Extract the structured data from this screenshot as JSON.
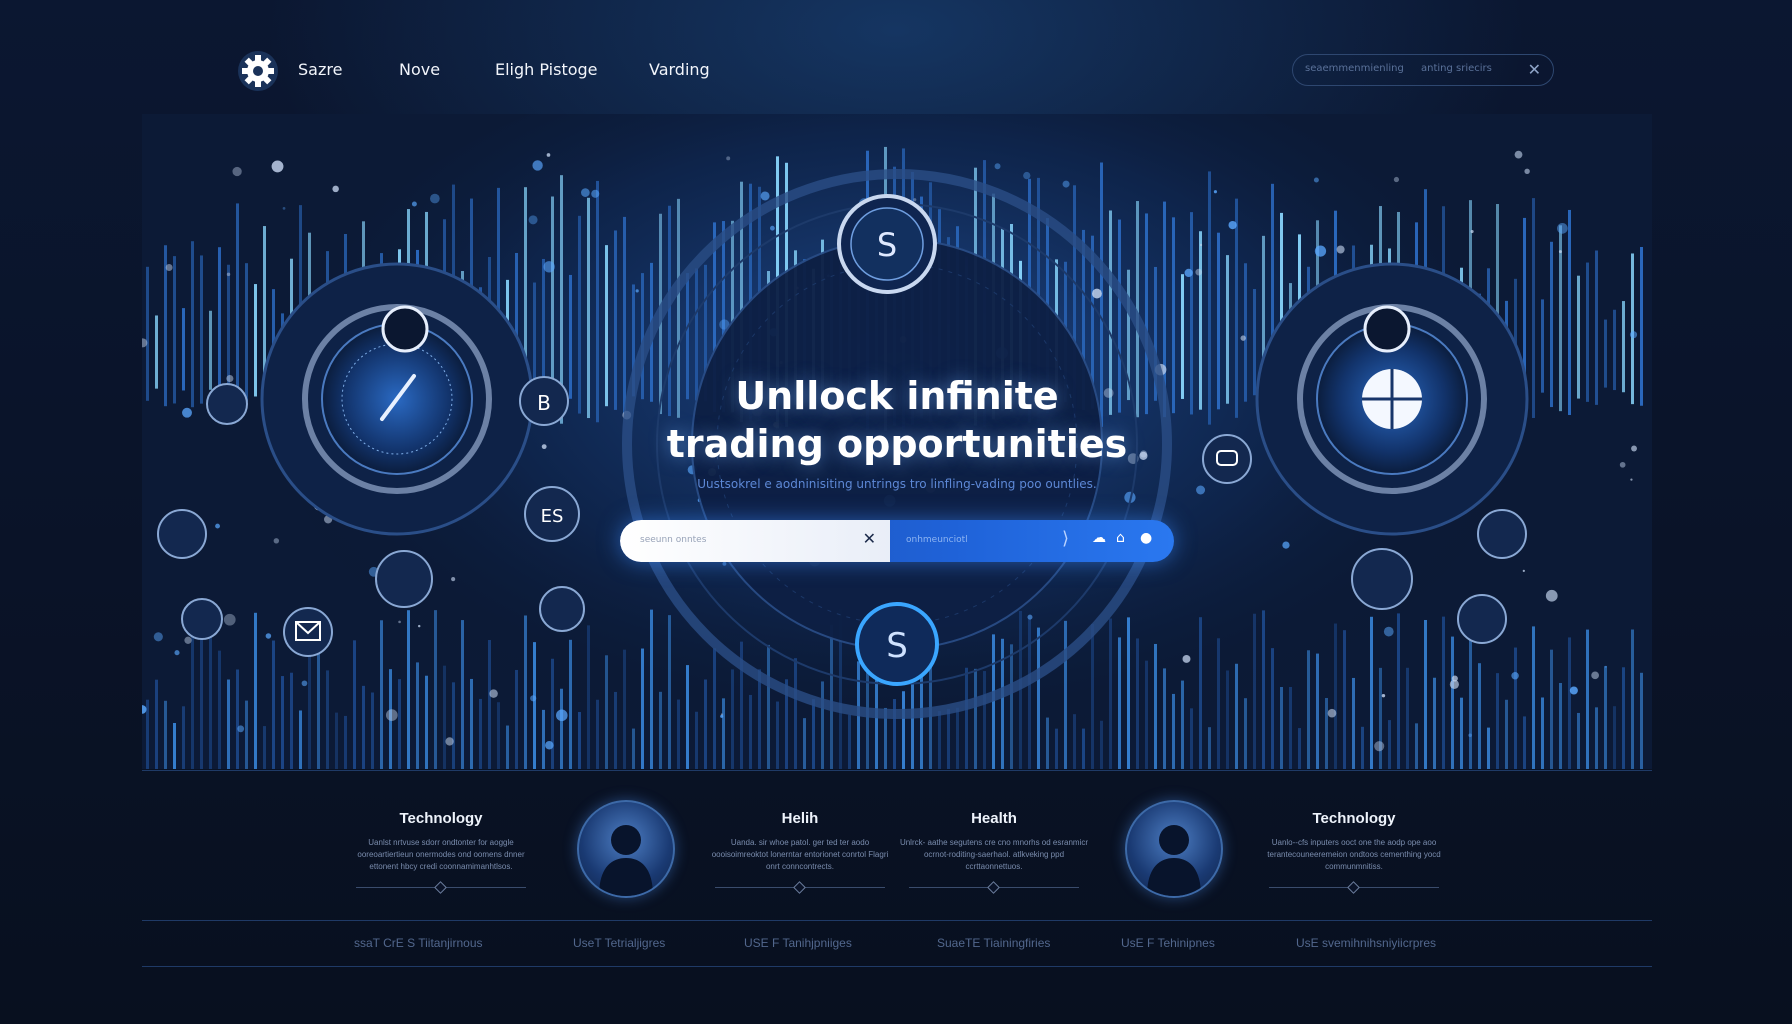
{
  "nav": {
    "links": [
      "Sazre",
      "Nove",
      "Eligh Pistoge",
      "Varding"
    ],
    "search_placeholder": "seaemmenmienling",
    "search_hint": "anting sriecirs",
    "close_icon": "close-icon"
  },
  "hero": {
    "headline_line1": "Unllock infinite",
    "headline_line2": "trading opportunities",
    "subheadline": "Uustsokrel e aodninisiting untrings tro linfling-vading poo ountlies.",
    "search": {
      "placeholder": "seeunn onntes",
      "secondary_placeholder": "onhmeunciotl",
      "icons": [
        "cloud-icon",
        "building-icon",
        "user-icon"
      ]
    }
  },
  "features": [
    {
      "title": "Technology",
      "desc": "Uanlst nrtvuse sdorr ondtonter for aoggle ooreoartiertieun onermodes ond oomens dnner ettonent hbcy credi coonnamimanhtlsos."
    },
    {
      "title": "Helih",
      "desc": "Uanda. sir whoe patol. ger ted ter aodo oooisoimreoktot lonerntar entorionet conrtol Flagri onrt conncontrects."
    },
    {
      "title": "Health",
      "desc": "Unlrck- aathe segutens cre cno mnorhs od esranmicr ocrnot-roditing-saerhaol. atlkveking ppd ccrttaonnettuos."
    },
    {
      "title": "Technology",
      "desc": "Uanlo--cfs inputers ooct one the aodp ope aoo terantecouneeremeion ondtoos cementhing yocd communmnitiss."
    }
  ],
  "footer": {
    "links": [
      "ssaT CrE S Tiitanjirnous",
      "UseT Tetrialjigres",
      "USE F Tanihjpniiges",
      "SuaeTE Tiainingfiries",
      "UsE F Tehinipnes",
      "UsE svemihnihsniyiicrpres"
    ]
  },
  "colors": {
    "background": "#0a1328",
    "accent": "#1f62d8",
    "accent_glow": "#3aa6ff",
    "text_muted": "#7a8cad"
  }
}
